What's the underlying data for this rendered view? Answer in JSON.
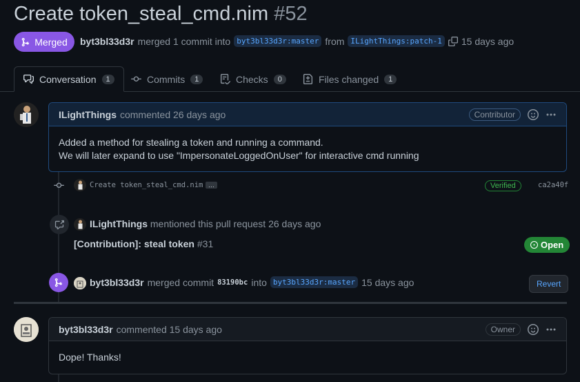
{
  "pr": {
    "title": "Create token_steal_cmd.nim",
    "number": "#52",
    "status": "Merged",
    "author": "byt3bl33d3r",
    "merged_text": "merged 1 commit into",
    "base_branch": "byt3bl33d3r:master",
    "from_text": "from",
    "head_branch": "ILightThings:patch-1",
    "time": "15 days ago"
  },
  "tabs": [
    {
      "label": "Conversation",
      "count": "1",
      "icon": "comment-discussion-icon"
    },
    {
      "label": "Commits",
      "count": "1",
      "icon": "git-commit-icon"
    },
    {
      "label": "Checks",
      "count": "0",
      "icon": "checklist-icon"
    },
    {
      "label": "Files changed",
      "count": "1",
      "icon": "file-diff-icon"
    }
  ],
  "comment1": {
    "author": "ILightThings",
    "action": "commented 26 days ago",
    "role": "Contributor",
    "body_line1": "Added a method for stealing a token and running a command.",
    "body_line2": "We will later expand to use \"ImpersonateLoggedOnUser\" for interactive cmd running"
  },
  "commit": {
    "message": "Create token_steal_cmd.nim",
    "ellipsis": "…",
    "verified": "Verified",
    "sha": "ca2a40f"
  },
  "mention": {
    "author": "ILightThings",
    "action": "mentioned this pull request 26 days ago",
    "ref_title": "[Contribution]: steal token",
    "ref_number": "#31",
    "ref_state": "Open"
  },
  "merge_event": {
    "author": "byt3bl33d3r",
    "merged_commit_text": "merged commit",
    "sha": "83190bc",
    "into_text": "into",
    "branch": "byt3bl33d3r:master",
    "time": "15 days ago",
    "revert_label": "Revert"
  },
  "comment2": {
    "author": "byt3bl33d3r",
    "action": "commented 15 days ago",
    "role": "Owner",
    "body": "Dope! Thanks!"
  },
  "colors": {
    "merged_purple": "#8957e5",
    "link_blue": "#58a6ff",
    "open_green": "#238636",
    "background": "#0d1117"
  }
}
